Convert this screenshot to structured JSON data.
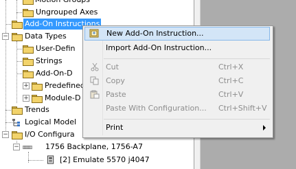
{
  "tree": {
    "items": [
      {
        "label": "Motion Groups"
      },
      {
        "label": "Ungrouped Axes"
      },
      {
        "label": "Add-On Instructions"
      },
      {
        "label": "Data Types"
      },
      {
        "label": "User-Defin"
      },
      {
        "label": "Strings"
      },
      {
        "label": "Add-On-D"
      },
      {
        "label": "Predefined"
      },
      {
        "label": "Module-D"
      },
      {
        "label": "Trends"
      },
      {
        "label": "Logical Model"
      },
      {
        "label": "I/O Configura"
      },
      {
        "label": "1756 Backplane, 1756-A7"
      },
      {
        "label": "[2] Emulate 5570 j4047"
      }
    ],
    "expander_minus": "−",
    "expander_plus": "+"
  },
  "context_menu": {
    "items": [
      {
        "label": "New Add-On Instruction...",
        "shortcut": "",
        "enabled": true,
        "highlighted": true,
        "icon": "new-add-on-icon"
      },
      {
        "label": "Import Add-On Instruction...",
        "shortcut": "",
        "enabled": true
      },
      {
        "label": "Cut",
        "shortcut": "Ctrl+X",
        "enabled": false,
        "icon": "cut-icon"
      },
      {
        "label": "Copy",
        "shortcut": "Ctrl+C",
        "enabled": false,
        "icon": "copy-icon"
      },
      {
        "label": "Paste",
        "shortcut": "Ctrl+V",
        "enabled": false,
        "icon": "paste-icon"
      },
      {
        "label": "Paste With Configuration...",
        "shortcut": "Ctrl+Shift+V",
        "enabled": false
      },
      {
        "label": "Print",
        "shortcut": "",
        "enabled": true,
        "submenu": true
      }
    ]
  },
  "colors": {
    "selection": "#3399ff",
    "menu_highlight": "#d3e5f7",
    "right_pane": "#acacac"
  }
}
